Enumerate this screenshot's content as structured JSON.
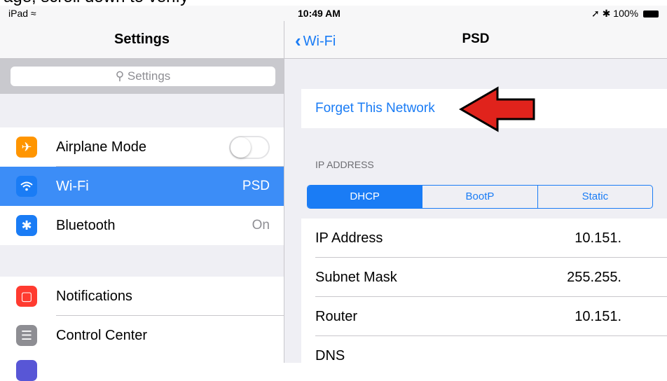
{
  "caption": "age, scroll down to verify",
  "status_bar": {
    "carrier": "iPad",
    "time": "10:49 AM",
    "battery": "100%"
  },
  "master": {
    "title": "Settings",
    "search_placeholder": "Settings",
    "rows": [
      {
        "label": "Airplane Mode",
        "icon": "airplane-icon",
        "color": "#ff9500",
        "toggle": false
      },
      {
        "label": "Wi-Fi",
        "icon": "wifi-icon",
        "color": "#1a7cf5",
        "value": "PSD",
        "selected": true
      },
      {
        "label": "Bluetooth",
        "icon": "bluetooth-icon",
        "color": "#1a7cf5",
        "value": "On"
      },
      {
        "label": "Notifications",
        "icon": "notifications-icon",
        "color": "#ff3b30"
      },
      {
        "label": "Control Center",
        "icon": "control-center-icon",
        "color": "#8e8e93"
      }
    ]
  },
  "detail": {
    "back_label": "Wi-Fi",
    "title": "PSD",
    "forget_label": "Forget This Network",
    "section_header": "IP ADDRESS",
    "segments": [
      "DHCP",
      "BootP",
      "Static"
    ],
    "selected_segment": "DHCP",
    "rows": [
      {
        "label": "IP Address",
        "value": "10.151."
      },
      {
        "label": "Subnet Mask",
        "value": "255.255."
      },
      {
        "label": "Router",
        "value": "10.151."
      },
      {
        "label": "DNS",
        "value": ""
      }
    ]
  },
  "annotation": {
    "type": "red-arrow",
    "color": "#e0231c",
    "points_to": "forget-network-button"
  },
  "colors": {
    "accent": "#1a7cf5",
    "selected_row": "#3c8df7",
    "group_bg": "#efeff4"
  }
}
